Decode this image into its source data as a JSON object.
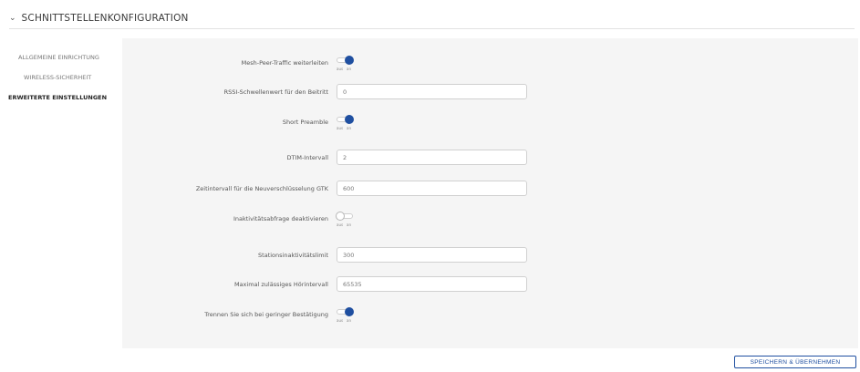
{
  "header": {
    "title": "SCHNITTSTELLENKONFIGURATION",
    "chevron": "chevron-down-icon"
  },
  "nav": {
    "items": [
      {
        "label": "ALLGEMEINE EINRICHTUNG"
      },
      {
        "label": "WIRELESS-SICHERHEIT"
      },
      {
        "label": "ERWEITERTE EINSTELLUNGEN",
        "active": true
      }
    ]
  },
  "form": {
    "toggle_caption_off": "aus",
    "toggle_caption_on": "an",
    "mesh_fwd": {
      "label": "Mesh-Peer-Traffic weiterleiten",
      "state": true
    },
    "rssi": {
      "label": "RSSI-Schwellenwert für den Beitritt",
      "value": "0"
    },
    "short_preamble": {
      "label": "Short Preamble",
      "state": true
    },
    "dtim": {
      "label": "DTIM-Intervall",
      "value": "2"
    },
    "gtk": {
      "label": "Zeitintervall für die Neuverschlüsselung GTK",
      "value": "600"
    },
    "inactivity": {
      "label": "Inaktivitätsabfrage deaktivieren",
      "state": false
    },
    "station_timeout": {
      "label": "Stationsinaktivitätslimit",
      "value": "300"
    },
    "listen_interval": {
      "label": "Maximal zulässiges Hörintervall",
      "value": "65535"
    },
    "low_ack": {
      "label": "Trennen Sie sich bei geringer Bestätigung",
      "state": true
    }
  },
  "actions": {
    "save_label": "SPEICHERN & ÜBERNEHMEN"
  },
  "colors": {
    "accent": "#1f4fa0",
    "panel_bg": "#f5f5f5",
    "border": "#d0d0d0"
  }
}
